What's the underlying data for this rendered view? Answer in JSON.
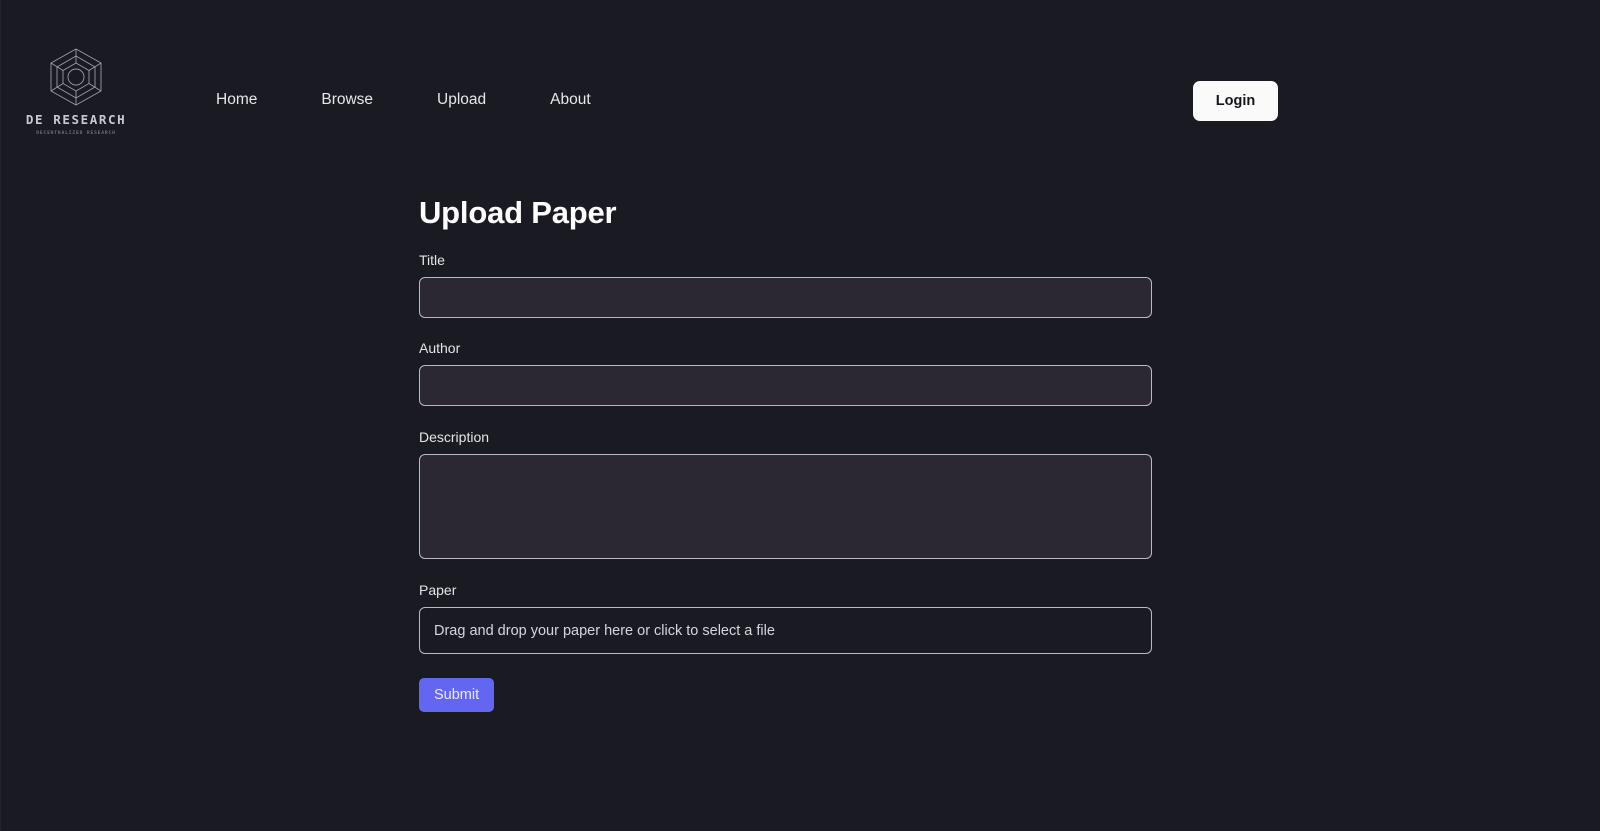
{
  "brand": {
    "name": "DE RESEARCH",
    "tagline": "DECENTRALIZED RESEARCH",
    "logo_icon": "hexagon-wireframe-icon"
  },
  "nav": {
    "items": [
      {
        "label": "Home"
      },
      {
        "label": "Browse"
      },
      {
        "label": "Upload"
      },
      {
        "label": "About"
      }
    ]
  },
  "header": {
    "login_label": "Login"
  },
  "main": {
    "title": "Upload Paper",
    "fields": {
      "title": {
        "label": "Title",
        "value": "",
        "placeholder": ""
      },
      "author": {
        "label": "Author",
        "value": "",
        "placeholder": ""
      },
      "description": {
        "label": "Description",
        "value": "",
        "placeholder": ""
      },
      "paper": {
        "label": "Paper",
        "dropzone_text": "Drag and drop your paper here or click to select a file"
      }
    },
    "submit_label": "Submit"
  },
  "colors": {
    "background": "#1a1a22",
    "input_fill": "#2b2833",
    "input_border": "#b9b9c4",
    "accent": "#6366f1",
    "login_bg": "#fafafa",
    "text": "#e8e8ee"
  }
}
